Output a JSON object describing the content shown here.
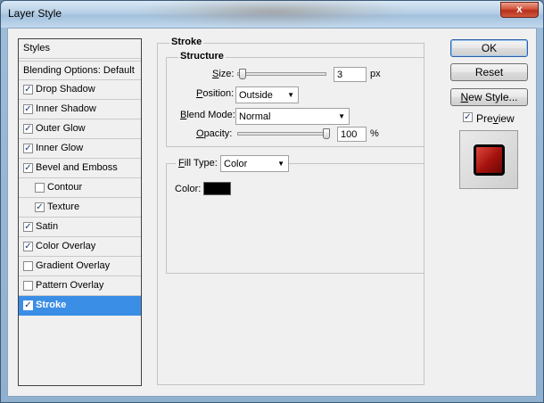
{
  "window": {
    "title": "Layer Style",
    "close": "x"
  },
  "styles_panel": {
    "header": "Styles",
    "blending": "Blending Options: Default",
    "items": [
      {
        "label": "Drop Shadow",
        "checked": true
      },
      {
        "label": "Inner Shadow",
        "checked": true
      },
      {
        "label": "Outer Glow",
        "checked": true
      },
      {
        "label": "Inner Glow",
        "checked": true
      },
      {
        "label": "Bevel and Emboss",
        "checked": true
      },
      {
        "label": "Contour",
        "checked": false
      },
      {
        "label": "Texture",
        "checked": true
      },
      {
        "label": "Satin",
        "checked": true
      },
      {
        "label": "Color Overlay",
        "checked": true
      },
      {
        "label": "Gradient Overlay",
        "checked": false
      },
      {
        "label": "Pattern Overlay",
        "checked": false
      },
      {
        "label": "Stroke",
        "checked": true,
        "selected": true
      }
    ]
  },
  "stroke": {
    "title": "Stroke",
    "structure_title": "Structure",
    "size_label_pre": "",
    "size_label_u": "S",
    "size_label_post": "ize:",
    "size_value": "3",
    "size_unit": "px",
    "size_slider_fraction": 0.02,
    "position_label_pre": "",
    "position_label_u": "P",
    "position_label_post": "osition:",
    "position_value": "Outside",
    "blend_label_pre": "",
    "blend_label_u": "B",
    "blend_label_post": "lend Mode:",
    "blend_value": "Normal",
    "opacity_label_pre": "",
    "opacity_label_u": "O",
    "opacity_label_post": "pacity:",
    "opacity_value": "100",
    "opacity_unit": "%",
    "opacity_slider_fraction": 1.0,
    "fill_type_label_u": "F",
    "fill_type_label_post": "ill Type:",
    "fill_type_value": "Color",
    "color_label": "Color:",
    "color_value": "#000000"
  },
  "buttons": {
    "ok": "OK",
    "reset": "Reset",
    "new_style_u": "N",
    "new_style_post": "ew Style...",
    "preview_u": "v",
    "preview_pre": "Pre",
    "preview_post": "iew",
    "preview_checked": true
  },
  "colors": {
    "selection": "#3a8ee6",
    "title_close": "#c9402a"
  }
}
